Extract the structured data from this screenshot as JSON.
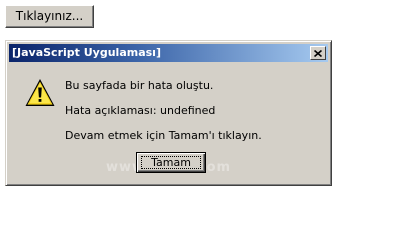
{
  "page": {
    "button_label": "Tıklayınız..."
  },
  "dialog": {
    "title": "[JavaScript Uygulaması]",
    "close_symbol": "×",
    "icon": "warning-icon",
    "messages": [
      "Bu sayfada bir hata oluştu.",
      "Hata açıklaması: undefined",
      "Devam etmek için Tamam'ı tıklayın."
    ],
    "ok_label": "Tamam",
    "watermark": "www.   ders.com"
  }
}
